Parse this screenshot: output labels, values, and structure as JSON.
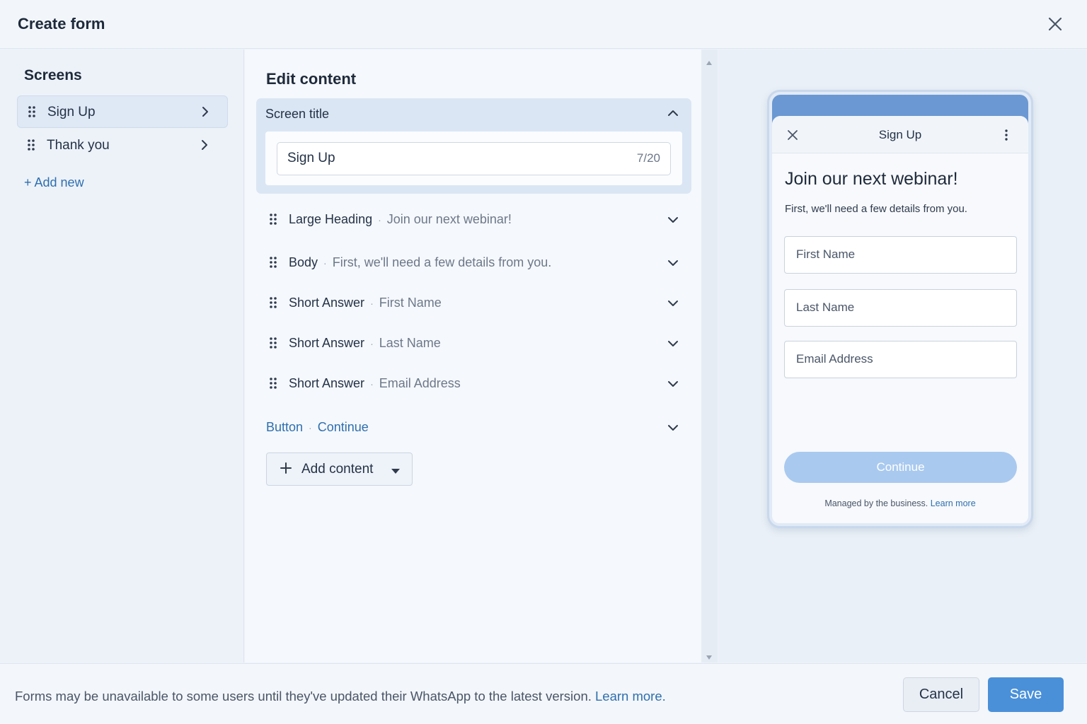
{
  "header": {
    "title": "Create form",
    "close_icon": "close-icon"
  },
  "sidebar": {
    "title": "Screens",
    "items": [
      {
        "label": "Sign Up",
        "active": true
      },
      {
        "label": "Thank you",
        "active": false
      }
    ],
    "add_new": "+ Add new"
  },
  "editor": {
    "title": "Edit content",
    "screen_title": {
      "label": "Screen title",
      "value": "Sign Up",
      "counter": "7/20"
    },
    "items": [
      {
        "type": "Large Heading",
        "separator": "·",
        "desc": "Join our next webinar!"
      },
      {
        "type": "Body",
        "separator": "·",
        "desc": "First, we'll need a few details from you."
      },
      {
        "type": "Short Answer",
        "separator": "·",
        "desc": "First Name"
      },
      {
        "type": "Short Answer",
        "separator": "·",
        "desc": "Last Name"
      },
      {
        "type": "Short Answer",
        "separator": "·",
        "desc": "Email Address"
      }
    ],
    "button_row": {
      "type": "Button",
      "separator": "·",
      "desc": "Continue"
    },
    "add_content": "Add content"
  },
  "preview": {
    "bar_title": "Sign Up",
    "heading": "Join our next webinar!",
    "body": "First, we'll need a few details from you.",
    "fields": [
      "First Name",
      "Last Name",
      "Email Address"
    ],
    "button": "Continue",
    "footer_text": "Managed by the business.",
    "footer_link": "Learn more"
  },
  "footer": {
    "note": "Forms may be unavailable to some users until they've updated their WhatsApp to the latest version.",
    "note_link": "Learn more.",
    "cancel": "Cancel",
    "save": "Save"
  },
  "colors": {
    "accent": "#4a90d9",
    "link": "#2f6fae",
    "preview_button": "#a9c9ef",
    "phone_header": "#6b98d2"
  }
}
